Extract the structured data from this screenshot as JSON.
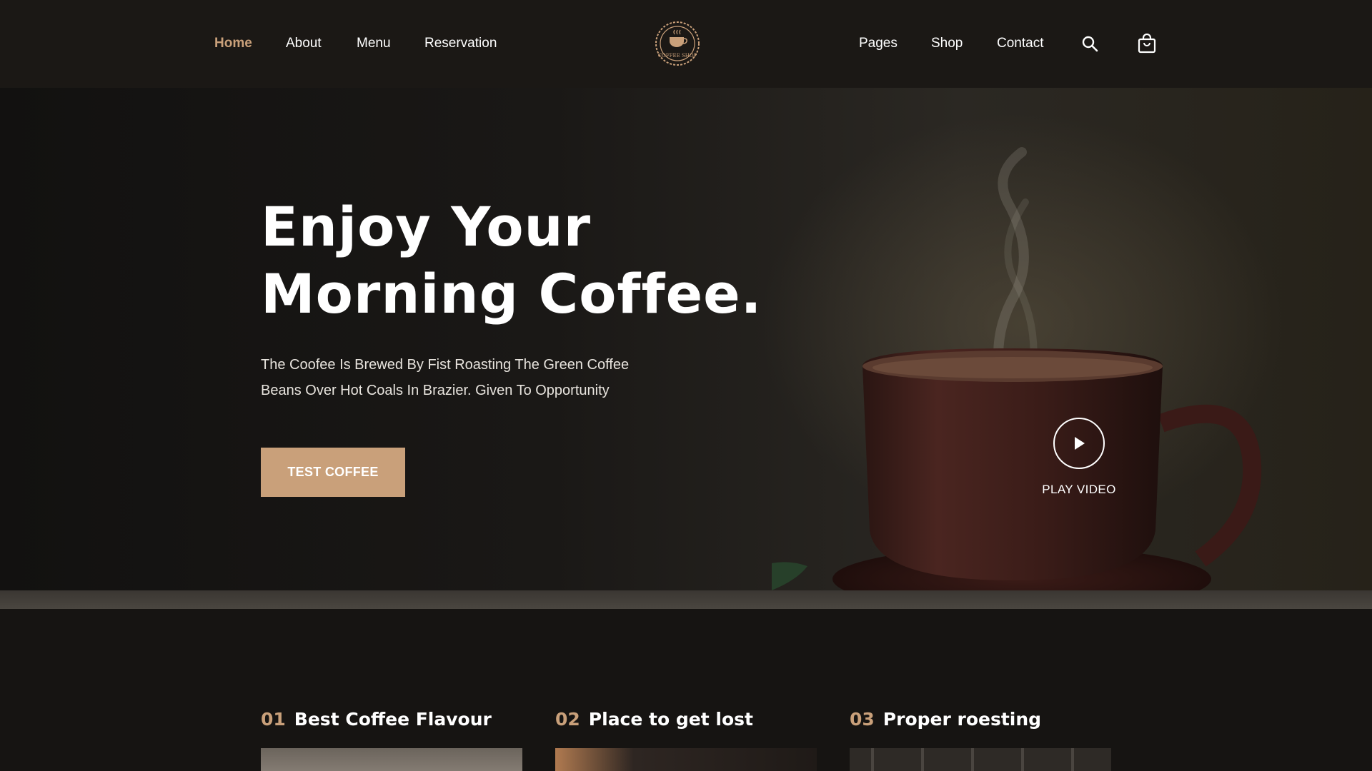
{
  "nav": {
    "left": [
      "Home",
      "About",
      "Menu",
      "Reservation"
    ],
    "right": [
      "Pages",
      "Shop",
      "Contact"
    ],
    "active": "Home"
  },
  "logo": {
    "text": "COFFEE SHOP"
  },
  "icons": {
    "search": "search-icon",
    "cart": "shopping-bag-icon",
    "play": "play-icon"
  },
  "hero": {
    "title_line1": "Enjoy Your",
    "title_line2": "Morning Coffee.",
    "desc_line1": "The Coofee Is Brewed By Fist Roasting The Green Coffee",
    "desc_line2": "Beans Over Hot Coals In Brazier. Given To Opportunity",
    "cta_label": "TEST COFFEE",
    "play_label": "PLAY VIDEO"
  },
  "features": [
    {
      "num": "01",
      "title": "Best Coffee Flavour"
    },
    {
      "num": "02",
      "title": "Place to get lost"
    },
    {
      "num": "03",
      "title": "Proper roesting"
    }
  ],
  "colors": {
    "accent": "#c9a07a",
    "background": "#161412",
    "header": "#1b1815"
  }
}
